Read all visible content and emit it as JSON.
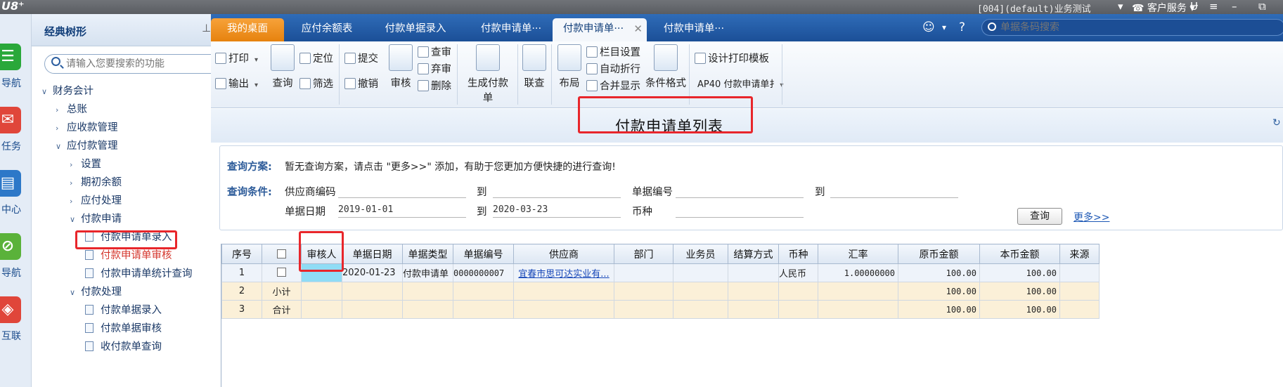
{
  "topbar": {
    "logo": "U8⁺",
    "account": "[004](default)业务测试",
    "service": "客户服务",
    "controls": [
      "▾",
      "Ʉ",
      "≡",
      "–",
      "⧉"
    ]
  },
  "nav": {
    "items": [
      {
        "label": "导航",
        "icon": "navigation-icon",
        "color": "#2aa83a"
      },
      {
        "label": "任务",
        "icon": "task-icon",
        "color": "#e0463a"
      },
      {
        "label": "中心",
        "icon": "center-icon",
        "color": "#2d78c8"
      },
      {
        "label": "导航",
        "icon": "compass-icon",
        "color": "#5ab23a"
      },
      {
        "label": "互联",
        "icon": "connect-icon",
        "color": "#e0463a"
      }
    ]
  },
  "tree": {
    "title": "经典树形",
    "search_placeholder": "请输入您要搜索的功能",
    "nodes": [
      {
        "label": "财务会计",
        "arrow": "∨"
      },
      {
        "label": "总账",
        "arrow": "›"
      },
      {
        "label": "应收款管理",
        "arrow": "›"
      },
      {
        "label": "应付款管理",
        "arrow": "∨"
      },
      {
        "label": "设置",
        "arrow": "›"
      },
      {
        "label": "期初余额",
        "arrow": "›"
      },
      {
        "label": "应付处理",
        "arrow": "›"
      },
      {
        "label": "付款申请",
        "arrow": "∨"
      },
      {
        "label": "付款申请单录入"
      },
      {
        "label": "付款申请单审核"
      },
      {
        "label": "付款申请单统计查询"
      },
      {
        "label": "付款处理",
        "arrow": "∨"
      },
      {
        "label": "付款单据录入"
      },
      {
        "label": "付款单据审核"
      },
      {
        "label": "收付款单查询"
      }
    ]
  },
  "tabs": {
    "items": [
      "我的桌面",
      "应付余额表",
      "付款单据录入",
      "付款申请单···",
      "付款申请单···",
      "付款申请单···"
    ],
    "search_placeholder": "单据条码搜索"
  },
  "toolbar": {
    "print": "打印",
    "export": "输出",
    "query": "查询",
    "locate": "定位",
    "filter": "筛选",
    "submit": "提交",
    "revoke": "撤销",
    "audit": "审核",
    "approve": "查审",
    "abandon": "弃审",
    "delete": "删除",
    "generate": "生成付款单",
    "linked_query": "联查",
    "layout": "布局",
    "column_settings": "栏目设置",
    "auto_wrap": "自动折行",
    "merge_display": "合并显示",
    "condition_format": "条件格式",
    "design_print": "设计打印模板",
    "template_select": "AP40 付款申请单扌"
  },
  "page_title": "付款申请单列表",
  "query": {
    "scheme_label": "查询方案:",
    "scheme_text": "暂无查询方案，请点击 \"更多>>\" 添加，有助于您更加方便快捷的进行查询!",
    "conditions_label": "查询条件:",
    "supplier_code": "供应商编码",
    "to": "到",
    "doc_no": "单据编号",
    "doc_date": "单据日期",
    "date_from": "2019-01-01",
    "date_to": "2020-03-23",
    "currency": "币种",
    "query_button": "查询",
    "more_link": "更多>>"
  },
  "grid": {
    "columns": [
      "序号",
      "",
      "审核人",
      "单据日期",
      "单据类型",
      "单据编号",
      "供应商",
      "部门",
      "业务员",
      "结算方式",
      "币种",
      "汇率",
      "原币金额",
      "本币金额",
      "来源"
    ],
    "rows": [
      [
        "1",
        "",
        "",
        "2020-01-23",
        "付款申请单",
        "0000000007",
        "宜春市思可达实业有...",
        "",
        "",
        "",
        "人民币",
        "1.00000000",
        "100.00",
        "100.00",
        ""
      ],
      [
        "2",
        "小计",
        "",
        "",
        "",
        "",
        "",
        "",
        "",
        "",
        "",
        "",
        "100.00",
        "100.00",
        ""
      ],
      [
        "3",
        "合计",
        "",
        "",
        "",
        "",
        "",
        "",
        "",
        "",
        "",
        "",
        "100.00",
        "100.00",
        ""
      ]
    ]
  },
  "colors": {
    "highlight_box": "#e8262b",
    "selected_cell": "#8fdcf5",
    "tab_home": "#f7a23a",
    "tab_bar": "#2f6cb8"
  }
}
